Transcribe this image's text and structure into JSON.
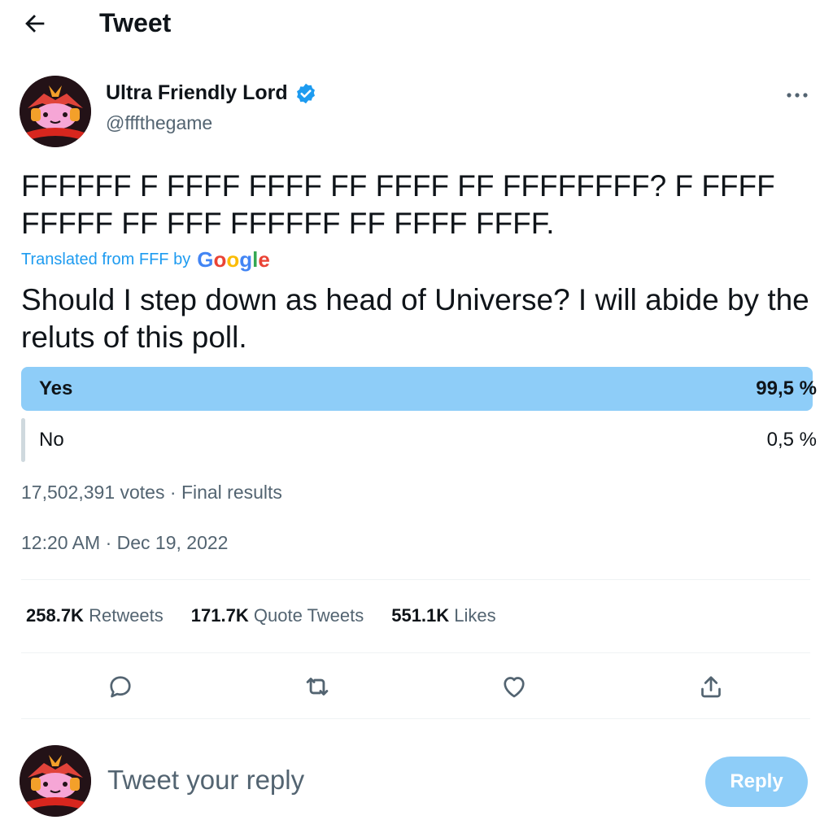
{
  "header": {
    "back_icon": "arrow-left-icon",
    "title": "Tweet"
  },
  "author": {
    "name": "Ultra Friendly Lord",
    "handle": "@fffthegame",
    "verified_icon": "verified-badge-icon",
    "more_icon": "more-horizontal-icon"
  },
  "tweet": {
    "text": "FFFFFF F FFFF FFFF FF FFFF FF FFFFFFFF? F FFFF FFFFF FF FFF FFFFFF FF FFFF FFFF.",
    "translated_label": "Translated from FFF by",
    "google_logo": "Google",
    "translated_text": "Should I step down as head of Universe? I will abide by the reluts of this poll."
  },
  "poll": {
    "options": [
      {
        "label": "Yes",
        "percent_text": "99,5 %",
        "percent": 99.5,
        "winner": true
      },
      {
        "label": "No",
        "percent_text": "0,5 %",
        "percent": 0.5,
        "winner": false
      }
    ],
    "votes": "17,502,391 votes",
    "status": "Final results",
    "separator": "·"
  },
  "timestamp": {
    "time": "12:20 AM",
    "separator": "·",
    "date": "Dec 19, 2022"
  },
  "stats": [
    {
      "value": "258.7K",
      "label": "Retweets"
    },
    {
      "value": "171.7K",
      "label": "Quote Tweets"
    },
    {
      "value": "551.1K",
      "label": "Likes"
    }
  ],
  "actions": [
    "reply-icon",
    "retweet-icon",
    "like-icon",
    "share-icon"
  ],
  "reply": {
    "placeholder": "Tweet your reply",
    "button_label": "Reply"
  },
  "colors": {
    "accent": "#1d9bf0",
    "poll_winner": "#8ecdf8",
    "poll_other": "#cfd9de",
    "secondary_text": "#536471",
    "reply_button_disabled": "#8ecdf8"
  }
}
